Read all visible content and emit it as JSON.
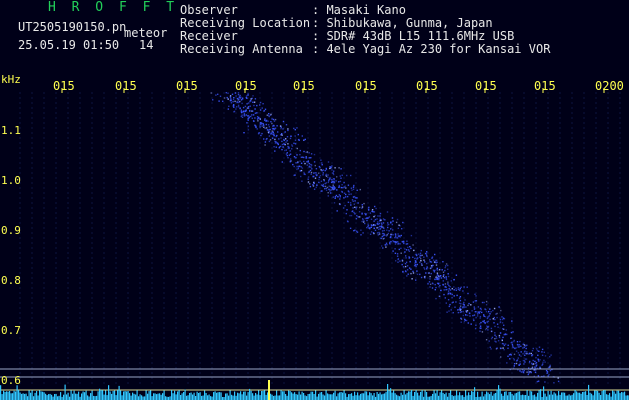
{
  "header": {
    "title": "H R O F F T",
    "filename": "UT2505190150.pn",
    "meteor_label": "meteor",
    "datetime": "25.05.19 01:50",
    "count": "14",
    "labels": [
      "Observer",
      "Receiving Location",
      "Receiver",
      "Receiving Antenna"
    ],
    "values": [
      ": Masaki Kano",
      ": Shibukawa, Gunma, Japan",
      ": SDR# 43dB L15 111.6MHz USB",
      ": 4ele Yagi Az 230 for Kansai VOR"
    ]
  },
  "time_axis": {
    "ticks": [
      "015",
      "015",
      "015",
      "015",
      "015",
      "015",
      "015",
      "015",
      "015",
      "0200"
    ],
    "tick_color": "#ffff50"
  },
  "freq_axis": {
    "unit": "kHz",
    "ticks": [
      "1.1",
      "1.0",
      "0.9",
      "0.8",
      "0.7",
      "0.6"
    ],
    "range": [
      0.6,
      1.1
    ]
  },
  "colors": {
    "background": "#000018",
    "trail": "#3a55ff",
    "trail_bright": "#9fb0ff",
    "baseline_lines": "#d8d890",
    "noise_floor": "#30c8ff"
  },
  "trail": {
    "start": {
      "time_fraction": 0.33,
      "freq_khz": 1.19
    },
    "end": {
      "time_fraction": 0.865,
      "freq_khz": 0.61
    }
  }
}
